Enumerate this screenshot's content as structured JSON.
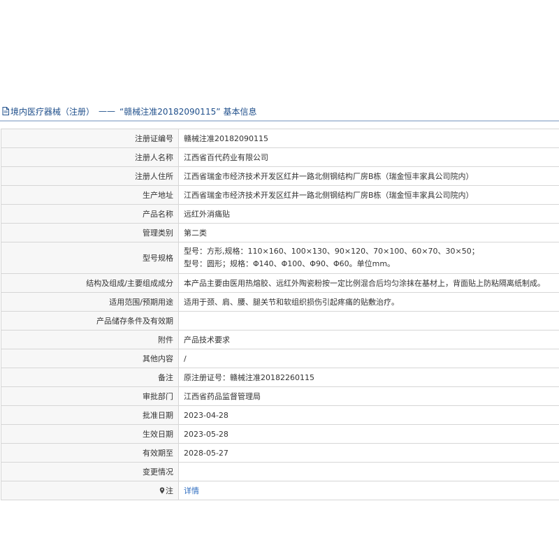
{
  "header": {
    "category": "境内医疗器械（注册）",
    "separator": "——",
    "reg_quote": "“赣械注准20182090115”",
    "suffix": "基本信息"
  },
  "rows": [
    {
      "label": "注册证编号",
      "value": "赣械注准20182090115"
    },
    {
      "label": "注册人名称",
      "value": "江西省百代药业有限公司"
    },
    {
      "label": "注册人住所",
      "value": "江西省瑞金市经济技术开发区红井一路北侧钢结构厂房B栋（瑞金恒丰家具公司院内）"
    },
    {
      "label": "生产地址",
      "value": "江西省瑞金市经济技术开发区红井一路北侧钢结构厂房B栋（瑞金恒丰家具公司院内）"
    },
    {
      "label": "产品名称",
      "value": "远红外消痛贴"
    },
    {
      "label": "管理类别",
      "value": "第二类"
    },
    {
      "label": "型号规格",
      "lines": [
        "型号：方形,规格：110×160、100×130、90×120、70×100、60×70、30×50；",
        "型号：圆形；规格：Φ140、Φ100、Φ90、Φ60。单位mm。"
      ]
    },
    {
      "label": "结构及组成/主要组成成分",
      "value": "本产品主要由医用热熔胶、远红外陶瓷粉按一定比例混合后均匀涂抹在基材上，背面贴上防粘隔离纸制成。"
    },
    {
      "label": "适用范围/预期用途",
      "value": "适用于颈、肩、腰、腿关节和软组织损伤引起疼痛的贴敷治疗。"
    },
    {
      "label": "产品储存条件及有效期",
      "value": ""
    },
    {
      "label": "附件",
      "value": "产品技术要求"
    },
    {
      "label": "其他内容",
      "value": "/"
    },
    {
      "label": "备注",
      "value": "原注册证号：赣械注准20182260115"
    },
    {
      "label": "审批部门",
      "value": "江西省药品监督管理局"
    },
    {
      "label": "批准日期",
      "value": "2023-04-28"
    },
    {
      "label": "生效日期",
      "value": "2023-05-28"
    },
    {
      "label": "有效期至",
      "value": "2028-05-27"
    },
    {
      "label": "变更情况",
      "value": ""
    },
    {
      "label": "注",
      "value": "详情"
    }
  ],
  "icons": {
    "title": "document-icon",
    "note": "pin-icon"
  },
  "colors": {
    "title": "#1f4f8b",
    "link": "#2d6cc0",
    "label_bg": "#f7f7f7",
    "border": "#d6d6d6"
  }
}
